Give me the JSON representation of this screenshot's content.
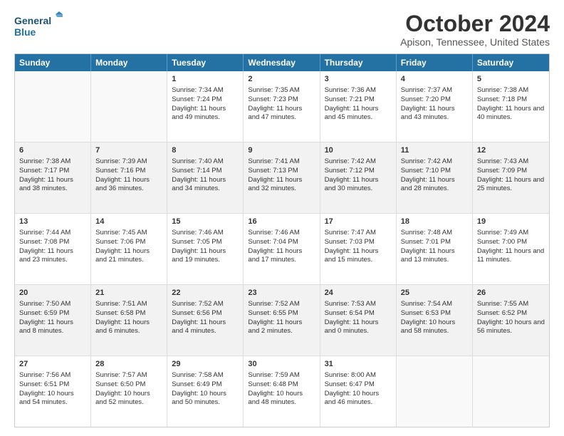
{
  "logo": {
    "line1": "General",
    "line2": "Blue"
  },
  "title": "October 2024",
  "location": "Apison, Tennessee, United States",
  "days_of_week": [
    "Sunday",
    "Monday",
    "Tuesday",
    "Wednesday",
    "Thursday",
    "Friday",
    "Saturday"
  ],
  "rows": [
    [
      {
        "day": "",
        "sunrise": "",
        "sunset": "",
        "daylight": ""
      },
      {
        "day": "",
        "sunrise": "",
        "sunset": "",
        "daylight": ""
      },
      {
        "day": "1",
        "sunrise": "Sunrise: 7:34 AM",
        "sunset": "Sunset: 7:24 PM",
        "daylight": "Daylight: 11 hours and 49 minutes."
      },
      {
        "day": "2",
        "sunrise": "Sunrise: 7:35 AM",
        "sunset": "Sunset: 7:23 PM",
        "daylight": "Daylight: 11 hours and 47 minutes."
      },
      {
        "day": "3",
        "sunrise": "Sunrise: 7:36 AM",
        "sunset": "Sunset: 7:21 PM",
        "daylight": "Daylight: 11 hours and 45 minutes."
      },
      {
        "day": "4",
        "sunrise": "Sunrise: 7:37 AM",
        "sunset": "Sunset: 7:20 PM",
        "daylight": "Daylight: 11 hours and 43 minutes."
      },
      {
        "day": "5",
        "sunrise": "Sunrise: 7:38 AM",
        "sunset": "Sunset: 7:18 PM",
        "daylight": "Daylight: 11 hours and 40 minutes."
      }
    ],
    [
      {
        "day": "6",
        "sunrise": "Sunrise: 7:38 AM",
        "sunset": "Sunset: 7:17 PM",
        "daylight": "Daylight: 11 hours and 38 minutes."
      },
      {
        "day": "7",
        "sunrise": "Sunrise: 7:39 AM",
        "sunset": "Sunset: 7:16 PM",
        "daylight": "Daylight: 11 hours and 36 minutes."
      },
      {
        "day": "8",
        "sunrise": "Sunrise: 7:40 AM",
        "sunset": "Sunset: 7:14 PM",
        "daylight": "Daylight: 11 hours and 34 minutes."
      },
      {
        "day": "9",
        "sunrise": "Sunrise: 7:41 AM",
        "sunset": "Sunset: 7:13 PM",
        "daylight": "Daylight: 11 hours and 32 minutes."
      },
      {
        "day": "10",
        "sunrise": "Sunrise: 7:42 AM",
        "sunset": "Sunset: 7:12 PM",
        "daylight": "Daylight: 11 hours and 30 minutes."
      },
      {
        "day": "11",
        "sunrise": "Sunrise: 7:42 AM",
        "sunset": "Sunset: 7:10 PM",
        "daylight": "Daylight: 11 hours and 28 minutes."
      },
      {
        "day": "12",
        "sunrise": "Sunrise: 7:43 AM",
        "sunset": "Sunset: 7:09 PM",
        "daylight": "Daylight: 11 hours and 25 minutes."
      }
    ],
    [
      {
        "day": "13",
        "sunrise": "Sunrise: 7:44 AM",
        "sunset": "Sunset: 7:08 PM",
        "daylight": "Daylight: 11 hours and 23 minutes."
      },
      {
        "day": "14",
        "sunrise": "Sunrise: 7:45 AM",
        "sunset": "Sunset: 7:06 PM",
        "daylight": "Daylight: 11 hours and 21 minutes."
      },
      {
        "day": "15",
        "sunrise": "Sunrise: 7:46 AM",
        "sunset": "Sunset: 7:05 PM",
        "daylight": "Daylight: 11 hours and 19 minutes."
      },
      {
        "day": "16",
        "sunrise": "Sunrise: 7:46 AM",
        "sunset": "Sunset: 7:04 PM",
        "daylight": "Daylight: 11 hours and 17 minutes."
      },
      {
        "day": "17",
        "sunrise": "Sunrise: 7:47 AM",
        "sunset": "Sunset: 7:03 PM",
        "daylight": "Daylight: 11 hours and 15 minutes."
      },
      {
        "day": "18",
        "sunrise": "Sunrise: 7:48 AM",
        "sunset": "Sunset: 7:01 PM",
        "daylight": "Daylight: 11 hours and 13 minutes."
      },
      {
        "day": "19",
        "sunrise": "Sunrise: 7:49 AM",
        "sunset": "Sunset: 7:00 PM",
        "daylight": "Daylight: 11 hours and 11 minutes."
      }
    ],
    [
      {
        "day": "20",
        "sunrise": "Sunrise: 7:50 AM",
        "sunset": "Sunset: 6:59 PM",
        "daylight": "Daylight: 11 hours and 8 minutes."
      },
      {
        "day": "21",
        "sunrise": "Sunrise: 7:51 AM",
        "sunset": "Sunset: 6:58 PM",
        "daylight": "Daylight: 11 hours and 6 minutes."
      },
      {
        "day": "22",
        "sunrise": "Sunrise: 7:52 AM",
        "sunset": "Sunset: 6:56 PM",
        "daylight": "Daylight: 11 hours and 4 minutes."
      },
      {
        "day": "23",
        "sunrise": "Sunrise: 7:52 AM",
        "sunset": "Sunset: 6:55 PM",
        "daylight": "Daylight: 11 hours and 2 minutes."
      },
      {
        "day": "24",
        "sunrise": "Sunrise: 7:53 AM",
        "sunset": "Sunset: 6:54 PM",
        "daylight": "Daylight: 11 hours and 0 minutes."
      },
      {
        "day": "25",
        "sunrise": "Sunrise: 7:54 AM",
        "sunset": "Sunset: 6:53 PM",
        "daylight": "Daylight: 10 hours and 58 minutes."
      },
      {
        "day": "26",
        "sunrise": "Sunrise: 7:55 AM",
        "sunset": "Sunset: 6:52 PM",
        "daylight": "Daylight: 10 hours and 56 minutes."
      }
    ],
    [
      {
        "day": "27",
        "sunrise": "Sunrise: 7:56 AM",
        "sunset": "Sunset: 6:51 PM",
        "daylight": "Daylight: 10 hours and 54 minutes."
      },
      {
        "day": "28",
        "sunrise": "Sunrise: 7:57 AM",
        "sunset": "Sunset: 6:50 PM",
        "daylight": "Daylight: 10 hours and 52 minutes."
      },
      {
        "day": "29",
        "sunrise": "Sunrise: 7:58 AM",
        "sunset": "Sunset: 6:49 PM",
        "daylight": "Daylight: 10 hours and 50 minutes."
      },
      {
        "day": "30",
        "sunrise": "Sunrise: 7:59 AM",
        "sunset": "Sunset: 6:48 PM",
        "daylight": "Daylight: 10 hours and 48 minutes."
      },
      {
        "day": "31",
        "sunrise": "Sunrise: 8:00 AM",
        "sunset": "Sunset: 6:47 PM",
        "daylight": "Daylight: 10 hours and 46 minutes."
      },
      {
        "day": "",
        "sunrise": "",
        "sunset": "",
        "daylight": ""
      },
      {
        "day": "",
        "sunrise": "",
        "sunset": "",
        "daylight": ""
      }
    ]
  ]
}
